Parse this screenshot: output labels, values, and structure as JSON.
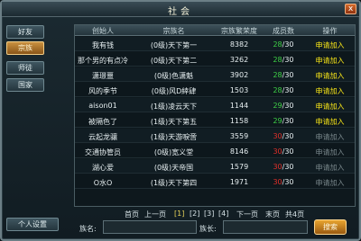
{
  "window": {
    "title": "社会",
    "close_label": "x"
  },
  "nav": [
    {
      "label": "好友",
      "active": false
    },
    {
      "label": "宗族",
      "active": true
    },
    {
      "label": "师徒",
      "active": false
    },
    {
      "label": "国家",
      "active": false
    }
  ],
  "settings_label": "个人设置",
  "table": {
    "headers": [
      "创始人",
      "宗族名",
      "宗族繁荣度",
      "成员数",
      "操作"
    ],
    "rows": [
      {
        "founder": "我有钱",
        "clan": "(0级)天下第一",
        "prosperity": "8382",
        "count": "28",
        "total": "30",
        "count_color": "green",
        "op": "申请加入",
        "op_enabled": true
      },
      {
        "founder": "那个男的有点冷",
        "clan": "(0级)天下第二",
        "prosperity": "3262",
        "count": "28",
        "total": "30",
        "count_color": "green",
        "op": "申请加入",
        "op_enabled": true
      },
      {
        "founder": "潇璟噩",
        "clan": "(0级)色潇魁",
        "prosperity": "3902",
        "count": "28",
        "total": "30",
        "count_color": "green",
        "op": "申请加入",
        "op_enabled": true
      },
      {
        "founder": "风的季节",
        "clan": "(0级)风D緈肆",
        "prosperity": "1503",
        "count": "28",
        "total": "30",
        "count_color": "green",
        "op": "申请加入",
        "op_enabled": true
      },
      {
        "founder": "aison01",
        "clan": "(1级)凌云天下",
        "prosperity": "1144",
        "count": "29",
        "total": "30",
        "count_color": "green",
        "op": "申请加入",
        "op_enabled": true
      },
      {
        "founder": "被隔色了",
        "clan": "(1级)天下第五",
        "prosperity": "1158",
        "count": "29",
        "total": "30",
        "count_color": "green",
        "op": "申请加入",
        "op_enabled": true
      },
      {
        "founder": "云起龙骧",
        "clan": "(1级)天游唳啻",
        "prosperity": "3559",
        "count": "30",
        "total": "30",
        "count_color": "red",
        "op": "申请加入",
        "op_enabled": false
      },
      {
        "founder": "交通协管员",
        "clan": "(0级)宽义堂",
        "prosperity": "8146",
        "count": "30",
        "total": "30",
        "count_color": "red",
        "op": "申请加入",
        "op_enabled": false
      },
      {
        "founder": "湖心爱",
        "clan": "(0级)天帝国",
        "prosperity": "1579",
        "count": "30",
        "total": "30",
        "count_color": "red",
        "op": "申请加入",
        "op_enabled": false
      },
      {
        "founder": "O水O",
        "clan": "(1级)天下第四",
        "prosperity": "1971",
        "count": "30",
        "total": "30",
        "count_color": "red",
        "op": "申请加入",
        "op_enabled": false
      }
    ]
  },
  "pager": {
    "first": "首页",
    "prev": "上一页",
    "pages": [
      "[1]",
      "[2]",
      "[3]",
      "[4]"
    ],
    "next": "下一页",
    "last": "末页",
    "total": "共4页"
  },
  "search": {
    "clan_label": "族名:",
    "clan_value": "",
    "leader_label": "族长:",
    "leader_value": "",
    "button_label": "搜索"
  },
  "colors": {
    "green": "#3ecf46",
    "red": "#e0302a",
    "yellow": "#f4e218"
  }
}
